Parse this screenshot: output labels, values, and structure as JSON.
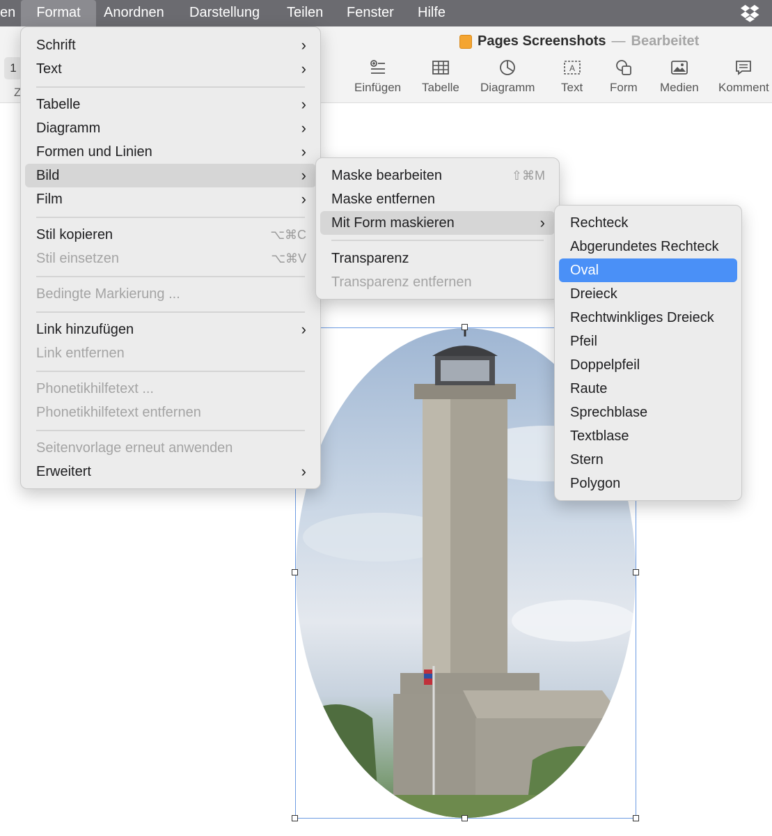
{
  "menubar": {
    "items": [
      {
        "label": "en"
      },
      {
        "label": "Format",
        "active": true
      },
      {
        "label": "Anordnen"
      },
      {
        "label": "Darstellung"
      },
      {
        "label": "Teilen"
      },
      {
        "label": "Fenster"
      },
      {
        "label": "Hilfe"
      }
    ],
    "status_icon": "dropbox-icon"
  },
  "window": {
    "doc_name": "Pages Screenshots",
    "separator": "—",
    "doc_state": "Bearbeitet",
    "left_stub_1": "1",
    "left_stub_z": "Z"
  },
  "toolbar": {
    "buttons": [
      {
        "label": "Einfügen",
        "icon": "insert-icon"
      },
      {
        "label": "Tabelle",
        "icon": "table-icon"
      },
      {
        "label": "Diagramm",
        "icon": "chart-icon"
      },
      {
        "label": "Text",
        "icon": "textbox-icon"
      },
      {
        "label": "Form",
        "icon": "shape-icon"
      },
      {
        "label": "Medien",
        "icon": "media-icon"
      },
      {
        "label": "Komment",
        "icon": "comment-icon"
      }
    ]
  },
  "format_menu": {
    "items": [
      {
        "label": "Schrift",
        "submenu": true
      },
      {
        "label": "Text",
        "submenu": true
      },
      {
        "label": "Tabelle",
        "submenu": true
      },
      {
        "label": "Diagramm",
        "submenu": true
      },
      {
        "label": "Formen und Linien",
        "submenu": true
      },
      {
        "label": "Bild",
        "submenu": true,
        "highlighted": true
      },
      {
        "label": "Film",
        "submenu": true
      },
      {
        "label": "Stil kopieren",
        "shortcut": "⌥⌘C"
      },
      {
        "label": "Stil einsetzen",
        "shortcut": "⌥⌘V",
        "disabled": true
      },
      {
        "label": "Bedingte Markierung ...",
        "disabled": true
      },
      {
        "label": "Link hinzufügen",
        "submenu": true
      },
      {
        "label": "Link entfernen",
        "disabled": true
      },
      {
        "label": "Phonetikhilfetext ...",
        "disabled": true
      },
      {
        "label": "Phonetikhilfetext entfernen",
        "disabled": true
      },
      {
        "label": "Seitenvorlage erneut anwenden",
        "disabled": true
      },
      {
        "label": "Erweitert",
        "submenu": true
      }
    ]
  },
  "bild_menu": {
    "items": [
      {
        "label": "Maske bearbeiten",
        "shortcut": "⇧⌘M"
      },
      {
        "label": "Maske entfernen"
      },
      {
        "label": "Mit Form maskieren",
        "submenu": true,
        "highlighted": true
      },
      {
        "label": "Transparenz"
      },
      {
        "label": "Transparenz entfernen",
        "disabled": true
      }
    ]
  },
  "shape_menu": {
    "items": [
      {
        "label": "Rechteck"
      },
      {
        "label": "Abgerundetes Rechteck"
      },
      {
        "label": "Oval",
        "selected": true
      },
      {
        "label": "Dreieck"
      },
      {
        "label": "Rechtwinkliges Dreieck"
      },
      {
        "label": "Pfeil"
      },
      {
        "label": "Doppelpfeil"
      },
      {
        "label": "Raute"
      },
      {
        "label": "Sprechblase"
      },
      {
        "label": "Textblase"
      },
      {
        "label": "Stern"
      },
      {
        "label": "Polygon"
      }
    ]
  },
  "colors": {
    "menubar": "#6b6b70",
    "selection_blue": "#4a90f7",
    "frame_blue": "#6c9be2"
  }
}
